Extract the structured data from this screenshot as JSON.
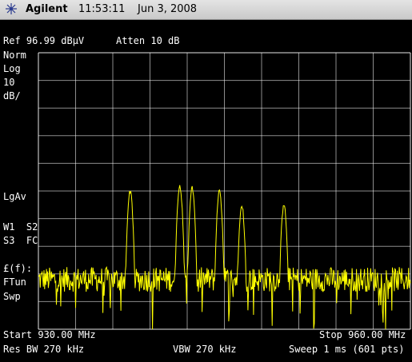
{
  "titlebar": {
    "brand": "Agilent",
    "time": "11:53:11",
    "date": "Jun 3, 2008",
    "logo_icon": "agilent-spark-icon"
  },
  "header": {
    "ref": "Ref 96.99 dBμV",
    "atten": "Atten 10 dB"
  },
  "left_annotations": {
    "norm": "Norm",
    "log": "Log",
    "scale_value": "10",
    "scale_unit": "dB/",
    "lgav": "LgAv",
    "w1s2": "W1  S2",
    "s3fc": "S3  FC",
    "ff": "£(f):",
    "ftun": "FTun",
    "swp": "Swp"
  },
  "footer": {
    "start": "Start 930.00 MHz",
    "stop": "Stop 960.00 MHz",
    "rbw": "Res BW 270 kHz",
    "vbw": "VBW 270 kHz",
    "sweep": "Sweep 1 ms (601 pts)"
  },
  "colors": {
    "trace": "#ffff00",
    "grid": "#ffffff",
    "background": "#000000"
  },
  "chart_data": {
    "type": "line",
    "x_range_mhz": [
      930,
      960
    ],
    "y_range_dbuv": [
      -3.01,
      96.99
    ],
    "ref_level_dbuv": 96.99,
    "scale_db_per_div": 10,
    "divisions": {
      "x": 10,
      "y": 10
    },
    "points_count": 601,
    "noise_floor_dbuv": 15,
    "peaks": [
      {
        "freq_mhz": 937.4,
        "level_dbuv": 47
      },
      {
        "freq_mhz": 941.4,
        "level_dbuv": 49
      },
      {
        "freq_mhz": 942.4,
        "level_dbuv": 48
      },
      {
        "freq_mhz": 944.6,
        "level_dbuv": 47
      },
      {
        "freq_mhz": 946.4,
        "level_dbuv": 42
      },
      {
        "freq_mhz": 949.8,
        "level_dbuv": 42
      }
    ]
  }
}
